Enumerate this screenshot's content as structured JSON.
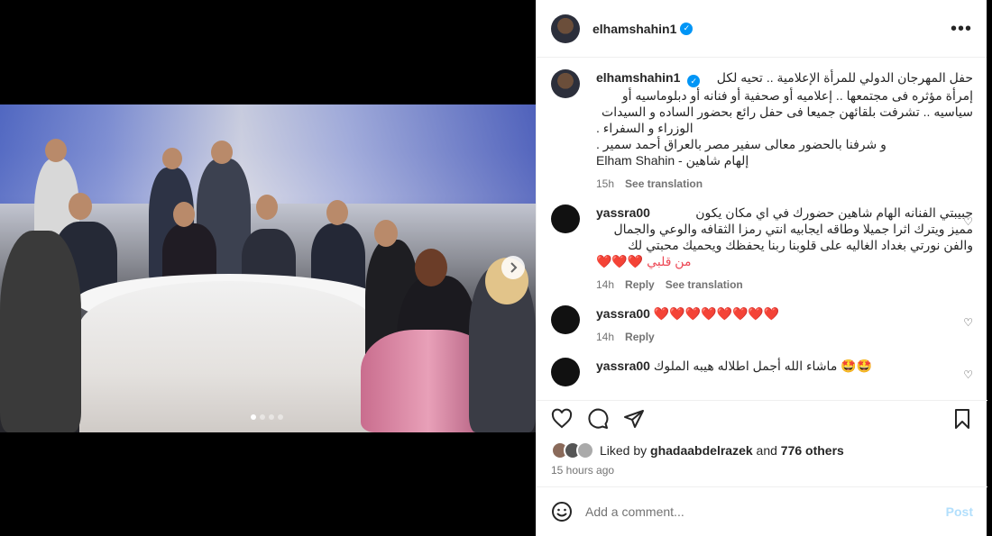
{
  "post": {
    "username": "elhamshahin1",
    "verified_icon": "verified-badge-icon",
    "more_icon": "more-horizontal-icon"
  },
  "caption": {
    "username": "elhamshahin1",
    "lines": [
      "حفل المهرجان الدولي للمرأة الإعلامية .. تحيه لكل",
      "إمرأة مؤثره فى مجتمعها .. إعلاميه أو صحفية أو فنانه أو دبلوماسيه أو",
      "سياسيه .. تشرفت بلقائهن جميعا فى حفل رائع بحضور الساده و السيدات",
      "الوزراء و السفراء .",
      "و شرفنا بالحضور معالى سفير مصر بالعراق أحمد سمير .",
      "Elham Shahin - إلهام شاهين"
    ],
    "time": "15h",
    "see_translation": "See translation"
  },
  "comments": [
    {
      "username": "yassra00",
      "lines": [
        "حبيبتي الفنانه الهام شاهين حضورك في اي مكان يكون",
        "مميز ويترك اثرا جميلا وطاقه ايجابيه انتي رمزا الثقافه والوعي والجمال",
        "والفن نورتي بغداد الغاليه على قلوبنا ربنا يحفظك ويحميك محبتي لك",
        "من قلبي ❤️❤️❤️"
      ],
      "time": "14h",
      "reply": "Reply",
      "see_translation": "See translation"
    },
    {
      "username": "yassra00",
      "lines": [
        "❤️❤️❤️❤️❤️❤️❤️❤️"
      ],
      "time": "14h",
      "reply": "Reply"
    },
    {
      "username": "yassra00",
      "lines": [
        "ماشاء الله أجمل اطلاله هيبه الملوك 🤩🤩"
      ]
    }
  ],
  "likes": {
    "prefix": "Liked by",
    "user": "ghadaabdelrazek",
    "and": "and",
    "others": "776 others"
  },
  "timestamp": "15 hours ago",
  "composer": {
    "placeholder": "Add a comment...",
    "post_label": "Post"
  },
  "icons": {
    "like": "heart-outline-icon",
    "comment": "comment-bubble-icon",
    "share": "send-paper-plane-icon",
    "save": "bookmark-icon",
    "emoji": "emoji-smiley-icon",
    "carousel_next": "chevron-right-icon"
  },
  "carousel": {
    "slide_count": 4,
    "active_index": 0
  }
}
